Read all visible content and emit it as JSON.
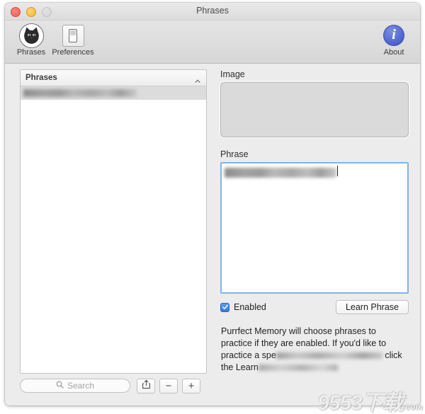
{
  "window": {
    "title": "Phrases",
    "traffic_lights": [
      "close-button",
      "minimize-button",
      "zoom-button"
    ]
  },
  "toolbar": {
    "items": [
      {
        "label": "Phrases",
        "icon": "cat-icon"
      },
      {
        "label": "Preferences",
        "icon": "switch-icon"
      },
      {
        "label": "About",
        "icon": "info-icon"
      }
    ],
    "accent_color": "#4a5fc8"
  },
  "sidebar": {
    "header": "Phrases",
    "sort_indicator": "chevron-up-icon",
    "rows": [
      {
        "text": "",
        "redacted": true,
        "selected": true
      }
    ]
  },
  "bottom_bar": {
    "search_placeholder": "Search",
    "search_value": "",
    "buttons": [
      {
        "name": "share-button",
        "symbol": "share-icon"
      },
      {
        "name": "remove-button",
        "symbol": "−"
      },
      {
        "name": "add-button",
        "symbol": "+"
      }
    ]
  },
  "detail": {
    "image_label": "Image",
    "image_value": "",
    "phrase_label": "Phrase",
    "phrase_value": "",
    "phrase_redacted": true,
    "enabled_label": "Enabled",
    "enabled_checked": true,
    "learn_button_label": "Learn Phrase",
    "description": "Purrfect Memory will choose phrases to practice if they are enabled. If you'd like to practice a spe",
    "description_line3_tail": "",
    "description_line4_head": "click the Learn"
  },
  "watermark": {
    "text": "9553下载",
    "domain": ".com"
  }
}
